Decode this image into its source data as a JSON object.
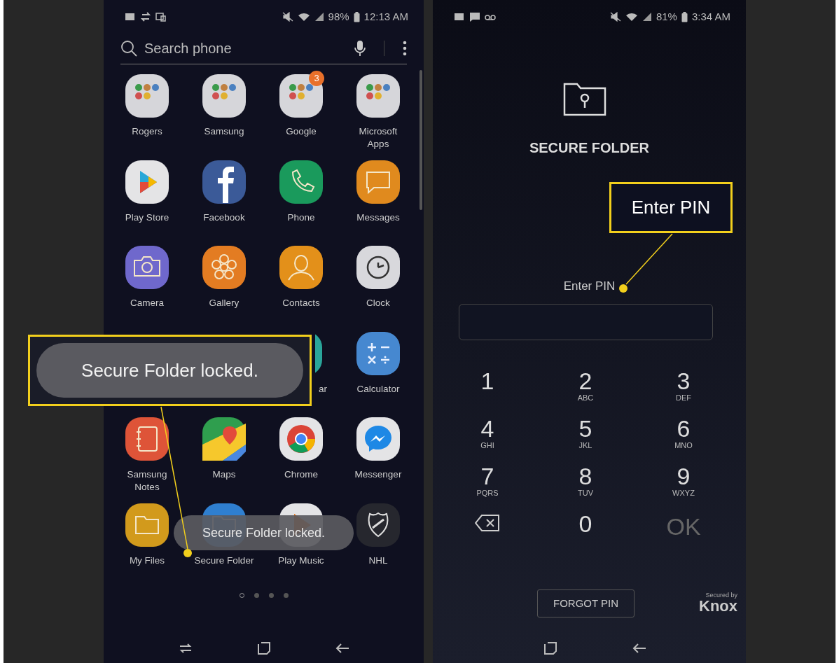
{
  "left_phone": {
    "status_bar": {
      "battery": "98%",
      "time": "12:13 AM"
    },
    "search": {
      "placeholder": "Search phone"
    },
    "app_rows": [
      [
        {
          "label": "Rogers",
          "kind": "folder"
        },
        {
          "label": "Samsung",
          "kind": "folder"
        },
        {
          "label": "Google",
          "kind": "folder",
          "badge": "3"
        },
        {
          "label": "Microsoft Apps",
          "kind": "folder"
        }
      ],
      [
        {
          "label": "Play Store",
          "kind": "play"
        },
        {
          "label": "Facebook",
          "kind": "facebook"
        },
        {
          "label": "Phone",
          "kind": "phone"
        },
        {
          "label": "Messages",
          "kind": "messages"
        }
      ],
      [
        {
          "label": "Camera",
          "kind": "camera"
        },
        {
          "label": "Gallery",
          "kind": "gallery"
        },
        {
          "label": "Contacts",
          "kind": "contacts"
        },
        {
          "label": "Clock",
          "kind": "clock"
        }
      ],
      [
        {
          "label": "ar",
          "kind": "partial"
        },
        {
          "label": "Calculator",
          "kind": "calculator"
        }
      ],
      [
        {
          "label": "Samsung Notes",
          "kind": "notes"
        },
        {
          "label": "Maps",
          "kind": "maps"
        },
        {
          "label": "Chrome",
          "kind": "chrome"
        },
        {
          "label": "Messenger",
          "kind": "messenger"
        }
      ],
      [
        {
          "label": "My Files",
          "kind": "myfiles"
        },
        {
          "label": "Secure Folder",
          "kind": "securefolder"
        },
        {
          "label": "Play Music",
          "kind": "playmusic"
        },
        {
          "label": "NHL",
          "kind": "nhl"
        }
      ]
    ],
    "page_dots": [
      {
        "selected": true
      },
      {
        "selected": false
      },
      {
        "selected": false
      },
      {
        "selected": false
      }
    ],
    "toast": "Secure Folder locked."
  },
  "right_phone": {
    "status_bar": {
      "battery": "81%",
      "time": "3:34 AM"
    },
    "title": "SECURE FOLDER",
    "pin_label": "Enter PIN",
    "keys": [
      {
        "kind": "digit",
        "digit": "1"
      },
      {
        "kind": "digit",
        "digit": "2",
        "letters": "ABC"
      },
      {
        "kind": "digit",
        "digit": "3",
        "letters": "DEF"
      },
      {
        "kind": "digit",
        "digit": "4",
        "letters": "GHI"
      },
      {
        "kind": "digit",
        "digit": "5",
        "letters": "JKL"
      },
      {
        "kind": "digit",
        "digit": "6",
        "letters": "MNO"
      },
      {
        "kind": "digit",
        "digit": "7",
        "letters": "PQRS"
      },
      {
        "kind": "digit",
        "digit": "8",
        "letters": "TUV"
      },
      {
        "kind": "digit",
        "digit": "9",
        "letters": "WXYZ"
      },
      {
        "kind": "backspace"
      },
      {
        "kind": "digit",
        "digit": "0"
      },
      {
        "kind": "ok",
        "digit": "OK",
        "disabled": true
      }
    ],
    "forgot_button": "FORGOT PIN",
    "knox": {
      "caption": "Secured by",
      "brand": "Knox"
    }
  },
  "callouts": [
    {
      "text": "Secure Folder locked."
    },
    {
      "text": "Enter PIN"
    }
  ]
}
